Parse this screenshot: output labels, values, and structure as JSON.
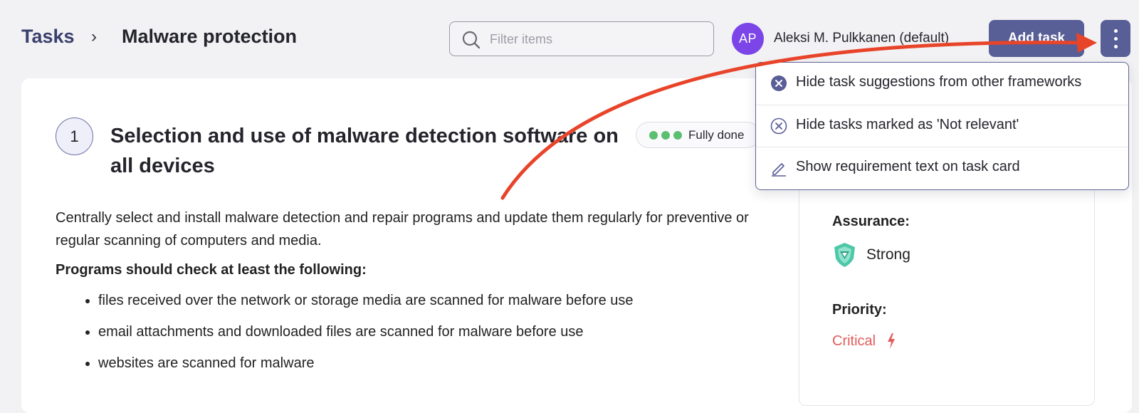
{
  "breadcrumb": {
    "root": "Tasks",
    "separator": "›",
    "current": "Malware protection"
  },
  "search": {
    "placeholder": "Filter items",
    "value": ""
  },
  "user": {
    "initials": "AP",
    "name": "Aleksi M. Pulkkanen (default)",
    "avatar_color": "#7b45e8"
  },
  "toolbar": {
    "add_task_label": "Add task",
    "more_icon": "kebab-menu-icon",
    "accent_color": "#585e96"
  },
  "dropdown": {
    "items": [
      {
        "label": "Hide task suggestions from other frameworks",
        "icon": "filled-close-circle-icon"
      },
      {
        "label": "Hide tasks marked as 'Not relevant'",
        "icon": "outline-close-circle-icon"
      },
      {
        "label": "Show requirement text on task card",
        "icon": "pencil-icon"
      }
    ]
  },
  "task": {
    "number": "1",
    "title": "Selection and use of malware detection software on all devices",
    "status": {
      "label": "Fully done",
      "dots_color": "#5bbf70"
    },
    "description": "Centrally select and install malware detection and repair programs and update them regularly for preventive or regular scanning of computers and media.",
    "programs_heading": "Programs should check at least the following:",
    "checks": [
      "files received over the network or storage media are scanned for malware before use",
      "email attachments and downloaded files are scanned for malware before use",
      "websites are scanned for malware"
    ]
  },
  "details": {
    "assurance_label": "Assurance:",
    "assurance_value": "Strong",
    "assurance_icon": "shield-icon",
    "priority_label": "Priority:",
    "priority_value": "Critical",
    "priority_icon": "lightning-bolt-icon",
    "priority_color": "#e25b5b"
  },
  "annotation": {
    "arrow_color": "#e8442a"
  }
}
